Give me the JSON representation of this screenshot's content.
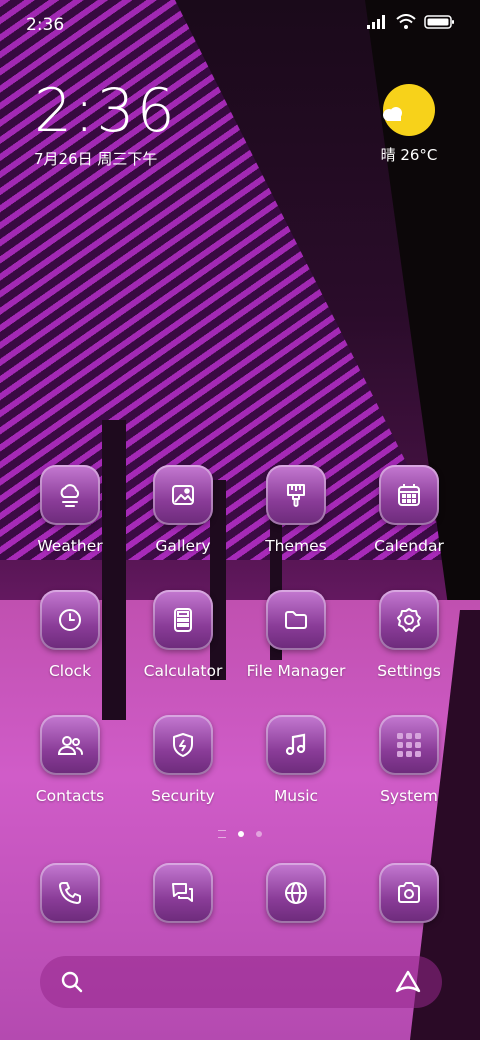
{
  "status_bar": {
    "time": "2:36"
  },
  "lock_clock": {
    "time": "2:36",
    "date": "7月26日 周三下午"
  },
  "weather": {
    "text": "晴 26°C"
  },
  "apps": [
    {
      "label": "Weather",
      "icon": "weather-icon"
    },
    {
      "label": "Gallery",
      "icon": "gallery-icon"
    },
    {
      "label": "Themes",
      "icon": "themes-brush-icon"
    },
    {
      "label": "Calendar",
      "icon": "calendar-icon"
    },
    {
      "label": "Clock",
      "icon": "clock-icon"
    },
    {
      "label": "Calculator",
      "icon": "calculator-icon"
    },
    {
      "label": "File Manager",
      "icon": "folder-icon"
    },
    {
      "label": "Settings",
      "icon": "gear-icon"
    },
    {
      "label": "Contacts",
      "icon": "contacts-icon"
    },
    {
      "label": "Security",
      "icon": "shield-icon"
    },
    {
      "label": "Music",
      "icon": "music-note-icon"
    },
    {
      "label": "System",
      "icon": "folder-grid-icon"
    }
  ],
  "page_indicator": {
    "active_page": 1
  },
  "dock": [
    {
      "icon": "phone-icon"
    },
    {
      "icon": "messages-icon"
    },
    {
      "icon": "browser-globe-icon"
    },
    {
      "icon": "camera-icon"
    }
  ],
  "colors": {
    "icon_tint": "#a04fb0",
    "sun": "#f7d21a"
  }
}
